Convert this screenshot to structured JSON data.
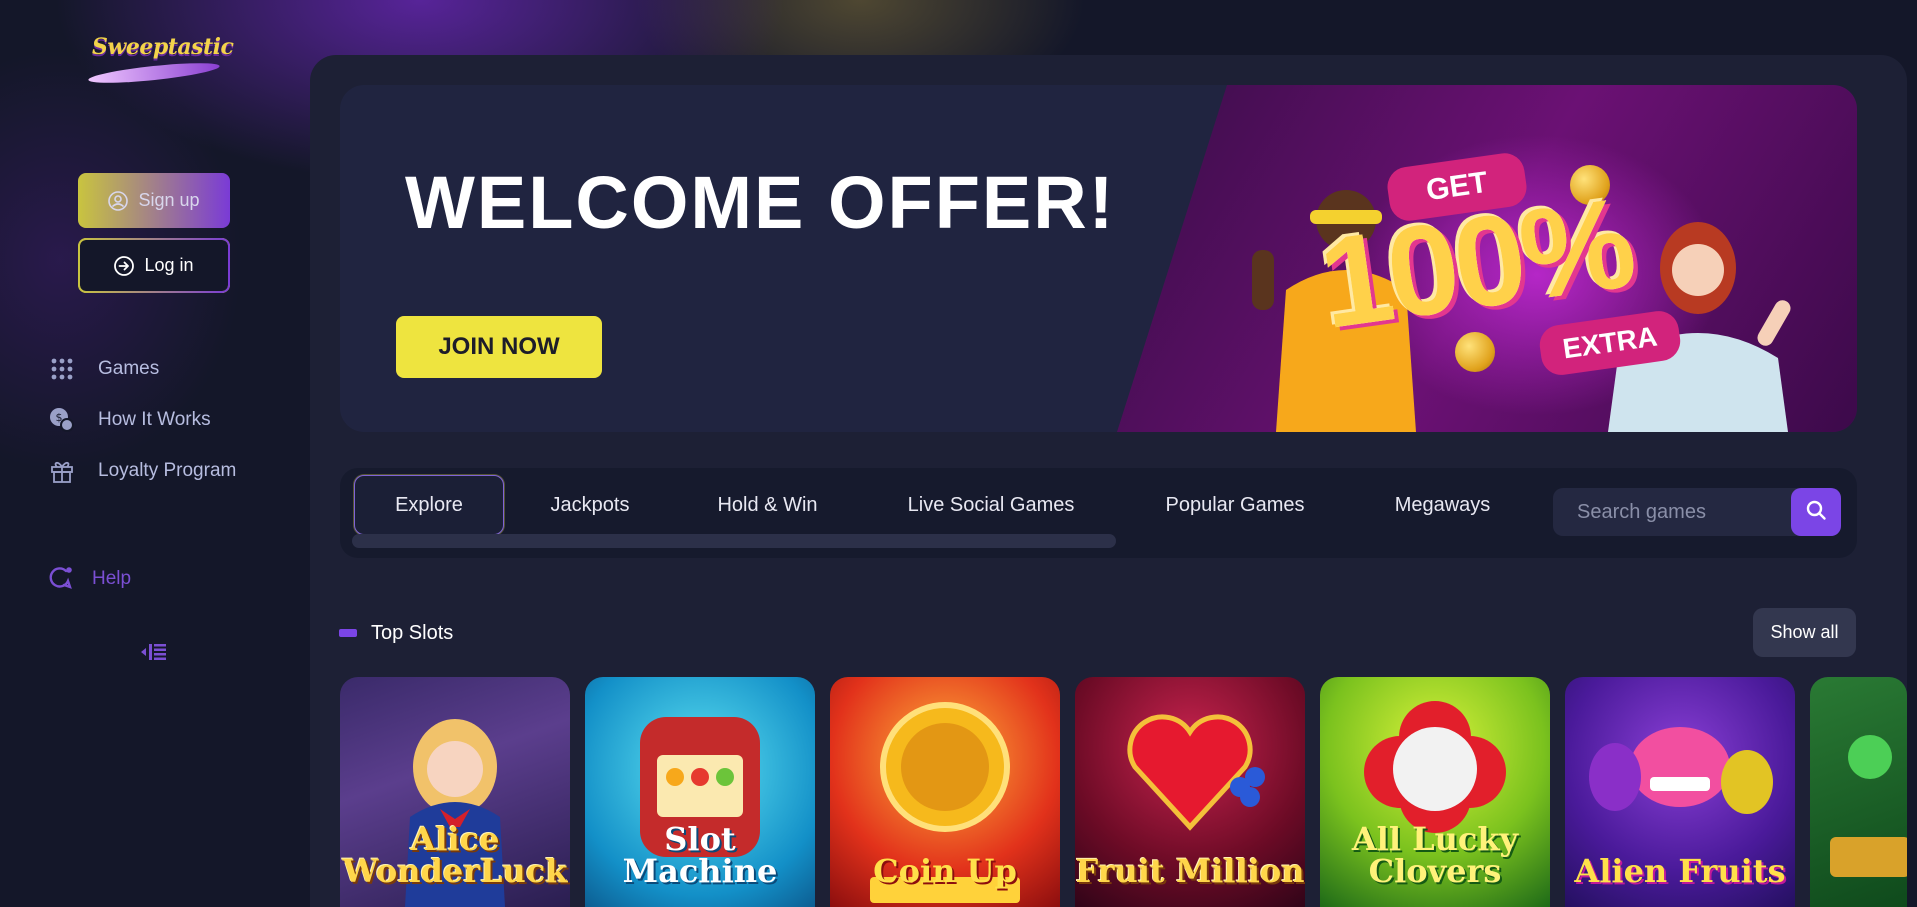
{
  "brand": {
    "logo_text": "Sweeptastic"
  },
  "auth": {
    "signup_label": "Sign up",
    "login_label": "Log in"
  },
  "sidebar": {
    "items": [
      {
        "label": "Games",
        "icon": "grid-icon"
      },
      {
        "label": "How It Works",
        "icon": "coins-icon"
      },
      {
        "label": "Loyalty Program",
        "icon": "gift-icon"
      }
    ],
    "help_label": "Help",
    "collapse_icon": "collapse-sidebar-icon"
  },
  "banner": {
    "title": "WELCOME OFFER!",
    "cta": "JOIN NOW",
    "promo_get": "GET",
    "promo_value": "100%",
    "promo_extra": "EXTRA"
  },
  "tabs": {
    "items": [
      "Explore",
      "Jackpots",
      "Hold & Win",
      "Live Social Games",
      "Popular Games",
      "Megaways"
    ],
    "active": "Explore"
  },
  "search": {
    "placeholder": "Search games",
    "value": ""
  },
  "section": {
    "title": "Top Slots",
    "show_all": "Show all",
    "games": [
      {
        "title": "Alice WonderLuck"
      },
      {
        "title": "Slot Machine"
      },
      {
        "title": "Coin Up"
      },
      {
        "title": "Fruit Million"
      },
      {
        "title": "All Lucky Clovers"
      },
      {
        "title": "Alien Fruits"
      }
    ]
  },
  "colors": {
    "background": "#141729",
    "panel": "#1d2035",
    "accent_purple": "#7b45e6",
    "accent_yellow": "#eee43f",
    "promo_pink": "#d2237c"
  }
}
